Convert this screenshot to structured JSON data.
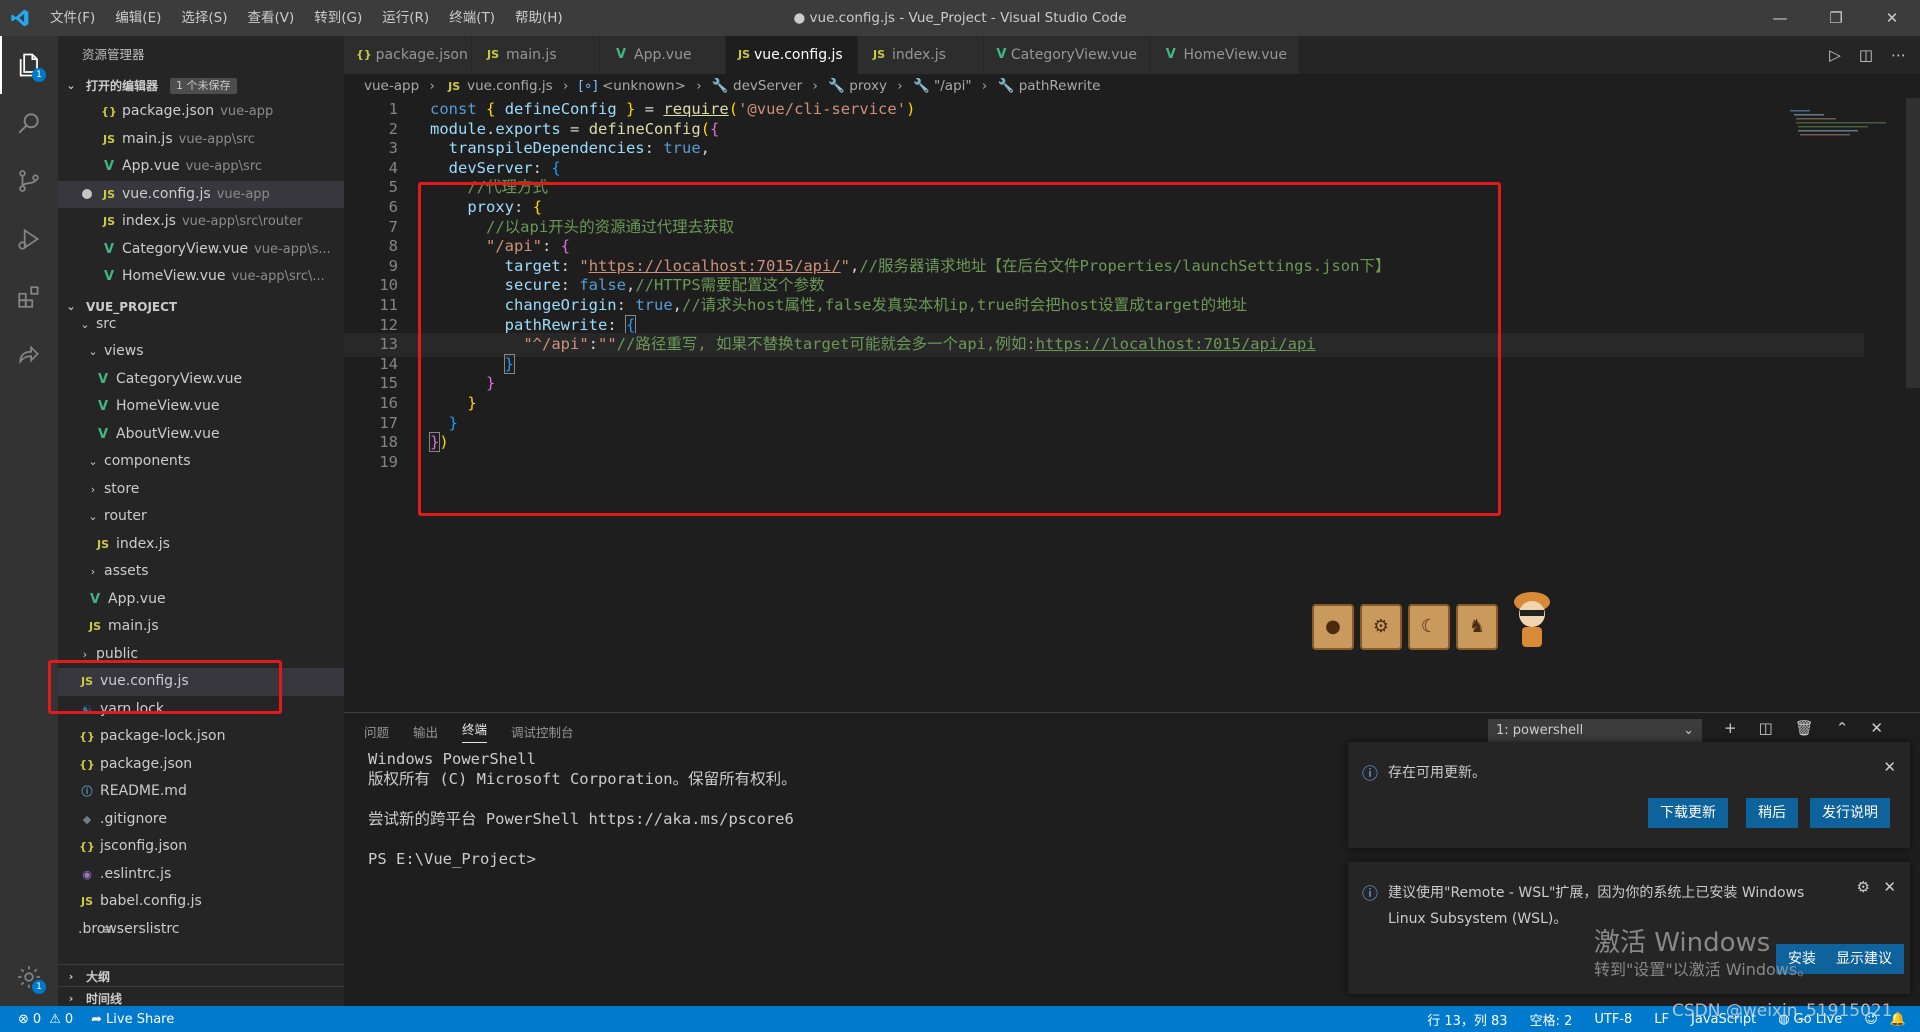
{
  "titlebar": {
    "menus": [
      "文件(F)",
      "编辑(E)",
      "选择(S)",
      "查看(V)",
      "转到(G)",
      "运行(R)",
      "终端(T)",
      "帮助(H)"
    ],
    "title": "● vue.config.js - Vue_Project - Visual Studio Code"
  },
  "activity": {
    "explorer_badge": "1",
    "settings_badge": "1"
  },
  "sidebar": {
    "title": "资源管理器",
    "open_editors": {
      "header": "打开的编辑器",
      "unsaved": "1 个未保存",
      "items": [
        {
          "icon": "{}",
          "type": "json",
          "name": "package.json",
          "desc": "vue-app"
        },
        {
          "icon": "JS",
          "type": "js",
          "name": "main.js",
          "desc": "vue-app\\src"
        },
        {
          "icon": "V",
          "type": "vue",
          "name": "App.vue",
          "desc": "vue-app\\src"
        },
        {
          "icon": "JS",
          "type": "js",
          "name": "vue.config.js",
          "desc": "vue-app"
        },
        {
          "icon": "JS",
          "type": "js",
          "name": "index.js",
          "desc": "vue-app\\src\\router"
        },
        {
          "icon": "V",
          "type": "vue",
          "name": "CategoryView.vue",
          "desc": "vue-app\\s..."
        },
        {
          "icon": "V",
          "type": "vue",
          "name": "HomeView.vue",
          "desc": "vue-app\\src\\..."
        }
      ]
    },
    "project": {
      "header": "VUE_PROJECT",
      "items": [
        {
          "label": "src",
          "kind": "folder-open"
        },
        {
          "label": "views",
          "kind": "folder-open"
        },
        {
          "label": "CategoryView.vue",
          "kind": "vue"
        },
        {
          "label": "HomeView.vue",
          "kind": "vue"
        },
        {
          "label": "AboutView.vue",
          "kind": "vue"
        },
        {
          "label": "components",
          "kind": "folder-open"
        },
        {
          "label": "store",
          "kind": "folder-closed"
        },
        {
          "label": "router",
          "kind": "folder-open"
        },
        {
          "label": "index.js",
          "kind": "js"
        },
        {
          "label": "assets",
          "kind": "folder-closed"
        },
        {
          "label": "App.vue",
          "kind": "vue"
        },
        {
          "label": "main.js",
          "kind": "js"
        },
        {
          "label": "public",
          "kind": "folder-closed"
        },
        {
          "label": "vue.config.js",
          "kind": "js"
        },
        {
          "label": "yarn.lock",
          "kind": "yarn"
        },
        {
          "label": "package-lock.json",
          "kind": "json"
        },
        {
          "label": "package.json",
          "kind": "json"
        },
        {
          "label": "README.md",
          "kind": "md"
        },
        {
          "label": ".gitignore",
          "kind": "git"
        },
        {
          "label": "jsconfig.json",
          "kind": "json"
        },
        {
          "label": ".eslintrc.js",
          "kind": "esl"
        },
        {
          "label": "babel.config.js",
          "kind": "js"
        },
        {
          "label": ".browserslistrc",
          "kind": "ln"
        }
      ]
    },
    "outline": "大纲",
    "timeline": "时间线"
  },
  "tabs": [
    {
      "icon": "{}",
      "type": "json",
      "label": "package.json"
    },
    {
      "icon": "JS",
      "type": "js",
      "label": "main.js"
    },
    {
      "icon": "V",
      "type": "vue",
      "label": "App.vue"
    },
    {
      "icon": "JS",
      "type": "js",
      "label": "vue.config.js",
      "active": true
    },
    {
      "icon": "JS",
      "type": "js",
      "label": "index.js"
    },
    {
      "icon": "V",
      "type": "vue",
      "label": "CategoryView.vue"
    },
    {
      "icon": "V",
      "type": "vue",
      "label": "HomeView.vue"
    }
  ],
  "breadcrumb": [
    "vue-app",
    "vue.config.js",
    "<unknown>",
    "devServer",
    "proxy",
    "\"/api\"",
    "pathRewrite"
  ],
  "editor": {
    "line_numbers": [
      "1",
      "2",
      "3",
      "4",
      "5",
      "6",
      "7",
      "8",
      "9",
      "10",
      "11",
      "12",
      "13",
      "14",
      "15",
      "16",
      "17",
      "18",
      "19"
    ]
  },
  "panel": {
    "tabs": [
      "问题",
      "输出",
      "终端",
      "调试控制台"
    ],
    "terminal_select": "1: powershell",
    "terminal_lines": [
      "Windows PowerShell",
      "版权所有 (C) Microsoft Corporation。保留所有权利。",
      "",
      "尝试新的跨平台 PowerShell https://aka.ms/pscore6",
      "",
      "PS E:\\Vue_Project>"
    ]
  },
  "notifications": {
    "update": {
      "text": "存在可用更新。",
      "buttons": [
        "下载更新",
        "稍后",
        "发行说明"
      ]
    },
    "wsl": {
      "text": "建议使用\"Remote - WSL\"扩展，因为你的系统上已安装 Windows",
      "text2": "Linux Subsystem (WSL)。",
      "buttons": [
        "安装",
        "显示建议"
      ]
    }
  },
  "watermark": {
    "line1": "激活 Windows",
    "line2": "转到\"设置\"以激活 Windows。",
    "csdn": "CSDN @weixin_51915021"
  },
  "statusbar": {
    "errors": "0",
    "warnings": "0",
    "liveshare": "Live Share",
    "position": "行 13，列 83",
    "spaces": "空格: 2",
    "encoding": "UTF-8",
    "eol": "LF",
    "language": "JavaScript",
    "golive": "Go Live"
  }
}
